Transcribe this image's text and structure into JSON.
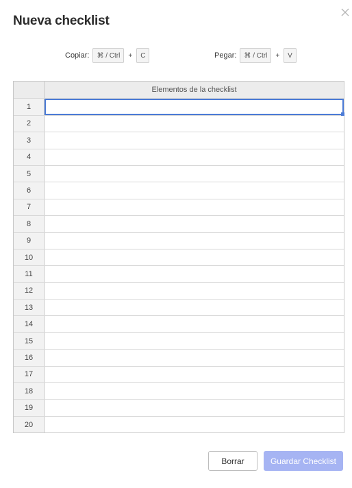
{
  "dialog": {
    "title": "Nueva checklist",
    "close_icon": "close-icon"
  },
  "shortcuts": {
    "copy": {
      "label": "Copiar:",
      "modifier": "⌘ / Ctrl",
      "plus": "+",
      "key": "C"
    },
    "paste": {
      "label": "Pegar:",
      "modifier": "⌘ / Ctrl",
      "plus": "+",
      "key": "V"
    }
  },
  "grid": {
    "column_header": "Elementos de la checklist",
    "rows": [
      "1",
      "2",
      "3",
      "4",
      "5",
      "6",
      "7",
      "8",
      "9",
      "10",
      "11",
      "12",
      "13",
      "14",
      "15",
      "16",
      "17",
      "18",
      "19",
      "20"
    ],
    "values": [
      "",
      "",
      "",
      "",
      "",
      "",
      "",
      "",
      "",
      "",
      "",
      "",
      "",
      "",
      "",
      "",
      "",
      "",
      "",
      ""
    ],
    "selected_row": 1
  },
  "buttons": {
    "clear_label": "Borrar",
    "save_label": "Guardar Checklist"
  },
  "colors": {
    "selection": "#4b7bd6",
    "save_button": "#a6b4f3"
  }
}
